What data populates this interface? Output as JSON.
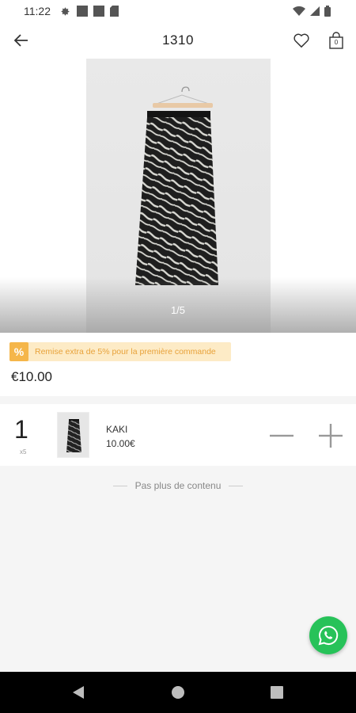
{
  "status_bar": {
    "time": "11:22",
    "icons": [
      "gear-icon",
      "square-icon",
      "square-icon",
      "sim-icon",
      "wifi-icon",
      "signal-icon",
      "battery-icon"
    ]
  },
  "header": {
    "title": "1310",
    "icons": [
      "back-arrow-icon",
      "heart-icon",
      "shopping-bag-icon"
    ],
    "bag_count": "0"
  },
  "gallery": {
    "pager": "1/5"
  },
  "product": {
    "promo_text": "Remise extra de 5% pour la première commande",
    "promo_icon": "percent-icon",
    "price": "€10.00",
    "colors": {
      "promo_bg": "#fdebc6",
      "promo_accent": "#f5b64a",
      "promo_text": "#e8a23a"
    }
  },
  "variant": {
    "quantity": "1",
    "quantity_sub": "x5",
    "name": "KAKI",
    "price": "10.00€"
  },
  "footer_note": "Pas plus de contenu",
  "whatsapp": {
    "icon": "whatsapp-icon",
    "color": "#27c259"
  },
  "nav_bar": {
    "icons": [
      "nav-back-icon",
      "nav-home-icon",
      "nav-recents-icon"
    ]
  }
}
